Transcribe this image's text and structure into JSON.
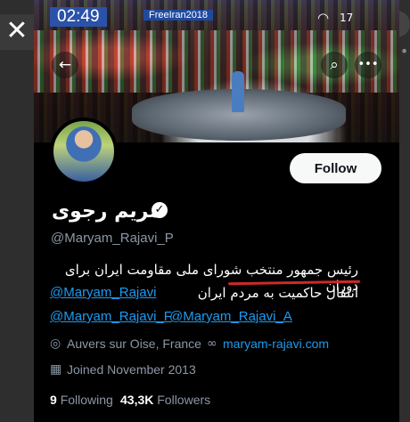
{
  "status_bar": {
    "time": "02:49",
    "battery": "17",
    "banner_tag": "FreeIran2018"
  },
  "profile": {
    "display_name": "مریم رجوی",
    "handle": "@Maryam_Rajavi_P",
    "follow_label": "Follow",
    "bio_line1": "رئیس جمهور منتخب شورای ملی مقاومت ایران برای دوران",
    "bio_line2": "انتقال حاکمیت به مردم ایران",
    "mentions": [
      "@Maryam_Rajavi",
      "@Maryam_Rajavi_F",
      "@Maryam_Rajavi_A"
    ],
    "location": "Auvers sur Oise, France",
    "website": "maryam-rajavi.com",
    "joined": "Joined November 2013",
    "following_count": "9",
    "following_label": "Following",
    "followers_count": "43,3K",
    "followers_label": "Followers"
  },
  "icons": {
    "close": "close-icon",
    "back": "arrow-left-icon",
    "search": "search-icon",
    "more": "more-icon",
    "verified": "verified-badge-icon",
    "location": "location-pin-icon",
    "link": "link-icon",
    "calendar": "calendar-icon"
  },
  "colors": {
    "accent": "#1d9bf0",
    "background": "#000000",
    "muted": "#8b98a5",
    "highlight": "#d02828"
  }
}
